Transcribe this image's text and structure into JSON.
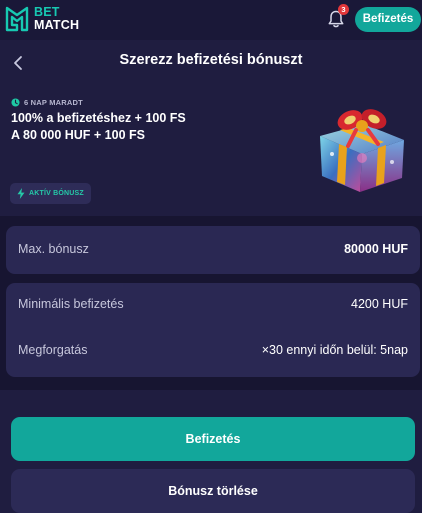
{
  "brand": {
    "line1": "BET",
    "line2": "MATCH",
    "logo_color": "#17c9b2"
  },
  "topbar": {
    "notification_count": "3",
    "deposit_label": "Befizetés"
  },
  "header": {
    "title": "Szerezz befizetési bónuszt"
  },
  "bonus": {
    "days_left": "6 NAP MARADT",
    "line1": "100% a befizetéshez + 100 FS",
    "line2": "A 80 000 HUF + 100 FS",
    "status_badge": "AKTÍV BÓNUSZ"
  },
  "details": [
    {
      "label": "Max. bónusz",
      "value": "80000 HUF"
    },
    {
      "label": "Minimális befizetés",
      "value": "4200 HUF"
    },
    {
      "label": "Megforgatás",
      "value": "×30 ennyi időn belül: 5nap"
    }
  ],
  "footer": {
    "deposit_button": "Befizetés",
    "remove_button": "Bónusz törlése"
  },
  "colors": {
    "accent": "#12a79b",
    "background": "#1f1d40",
    "card": "#2a2853",
    "badge_red": "#e2363a"
  },
  "icons": [
    "logo-icon",
    "bell-icon",
    "back-chevron-icon",
    "clock-icon",
    "bolt-icon",
    "gift-icon"
  ]
}
